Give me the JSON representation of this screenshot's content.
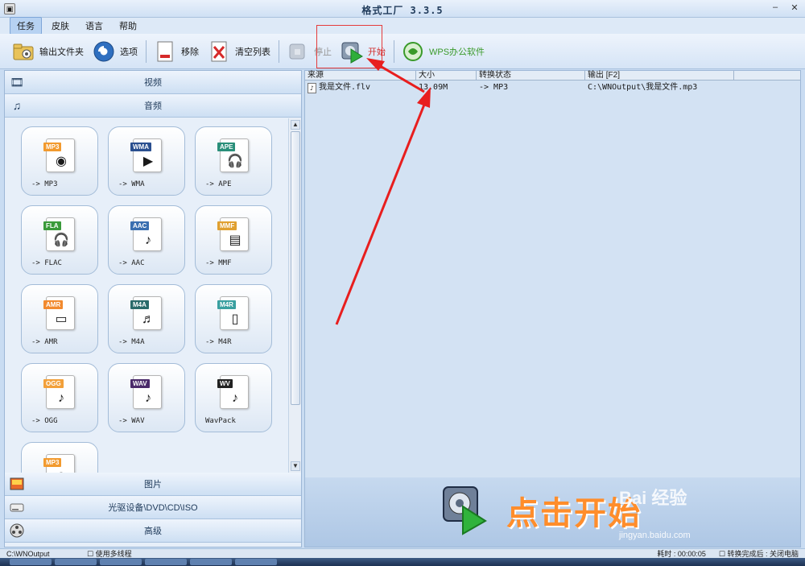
{
  "window": {
    "title": "格式工厂 3.3.5",
    "min": "–",
    "close": "✕"
  },
  "menu": [
    "任务",
    "皮肤",
    "语言",
    "帮助"
  ],
  "toolbar": {
    "output_folder": "输出文件夹",
    "options": "选项",
    "remove": "移除",
    "clear_list": "清空列表",
    "stop": "停止",
    "start": "开始",
    "wps": "WPS办公软件"
  },
  "left": {
    "video": "视频",
    "audio": "音频",
    "image": "图片",
    "optical": "光驱设备\\DVD\\CD\\ISO",
    "advanced": "高级"
  },
  "tiles": [
    {
      "tag": "MP3",
      "label": "-> MP3",
      "tag_color": "#f29a2e",
      "icon": "speaker-icon"
    },
    {
      "tag": "WMA",
      "label": "-> WMA",
      "tag_color": "#2a4f8f",
      "icon": "play-disc-icon"
    },
    {
      "tag": "APE",
      "label": "-> APE",
      "tag_color": "#2a8f7a",
      "icon": "headphones-icon"
    },
    {
      "tag": "FLA",
      "label": "-> FLAC",
      "tag_color": "#3a9a3a",
      "icon": "headphones-icon"
    },
    {
      "tag": "AAC",
      "label": "-> AAC",
      "tag_color": "#3a6fb0",
      "icon": "music-note-icon"
    },
    {
      "tag": "MMF",
      "label": "-> MMF",
      "tag_color": "#e0a030",
      "icon": "document-icon"
    },
    {
      "tag": "AMR",
      "label": "-> AMR",
      "tag_color": "#f28a2e",
      "icon": "laptop-icon"
    },
    {
      "tag": "M4A",
      "label": "-> M4A",
      "tag_color": "#2a6a6a",
      "icon": "music-disc-icon"
    },
    {
      "tag": "M4R",
      "label": "-> M4R",
      "tag_color": "#3aa0a0",
      "icon": "phone-icon"
    },
    {
      "tag": "OGG",
      "label": "-> OGG",
      "tag_color": "#f2a03a",
      "icon": "music-note-icon"
    },
    {
      "tag": "WAV",
      "label": "-> WAV",
      "tag_color": "#4a2a6a",
      "icon": "music-note-icon"
    },
    {
      "tag": "WV",
      "label": "WavPack",
      "tag_color": "#222222",
      "icon": "music-note-icon"
    },
    {
      "tag": "MP3",
      "label": "",
      "tag_color": "#f29a2e",
      "icon": "speaker-icon"
    }
  ],
  "table": {
    "headers": [
      "来源",
      "大小",
      "转换状态",
      "输出 [F2]"
    ],
    "rows": [
      {
        "source": "我是文件.flv",
        "size": "13.09M",
        "status": "-> MP3",
        "output": "C:\\WNOutput\\我是文件.mp3"
      }
    ]
  },
  "banner": {
    "text": "点击开始",
    "watermark": "Bai 经验",
    "watermark_url": "jingyan.baidu.com"
  },
  "status": {
    "path": "C:\\WNOutput",
    "multithread": "使用多线程",
    "elapsed": "耗时 : 00:00:05",
    "after": "转换完成后 : 关闭电脑"
  }
}
